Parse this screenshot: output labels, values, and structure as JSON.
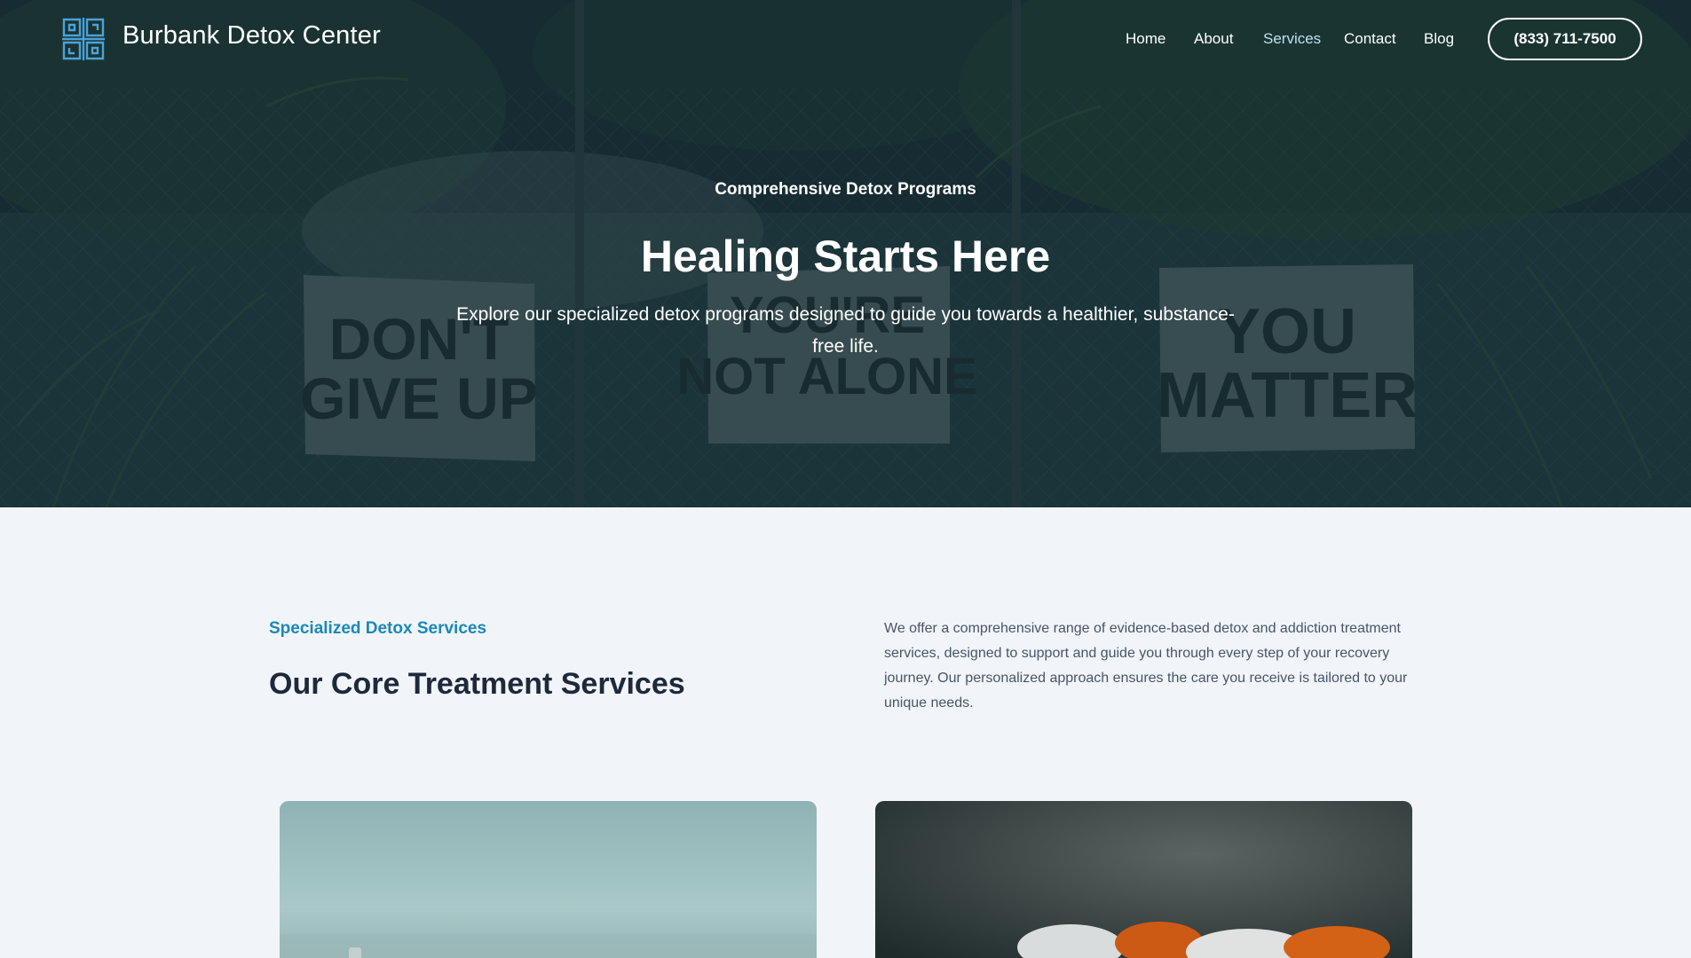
{
  "header": {
    "brand": "Burbank Detox Center",
    "nav": [
      {
        "label": "Home",
        "active": false
      },
      {
        "label": "About",
        "active": false
      },
      {
        "label": "Services",
        "active": true
      },
      {
        "label": "Contact",
        "active": false
      },
      {
        "label": "Blog",
        "active": false
      }
    ],
    "phone": "(833) 711-7500"
  },
  "hero": {
    "eyebrow": "Comprehensive Detox Programs",
    "title": "Healing Starts Here",
    "subtitle": "Explore our specialized detox programs designed to guide you towards a healthier, substance-free life.",
    "signs": [
      "DON'T GIVE UP",
      "YOU'RE NOT ALONE",
      "YOU MATTER"
    ]
  },
  "services": {
    "kicker": "Specialized Detox Services",
    "title": "Our Core Treatment Services",
    "description": "We offer a comprehensive range of evidence-based detox and addiction treatment services, designed to support and guide you through every step of your recovery journey. Our personalized approach ensures the care you receive is tailored to your unique needs."
  },
  "colors": {
    "accent": "#1b88b8",
    "page_bg": "#f1f5f9",
    "hero_overlay": "#0c2228"
  }
}
